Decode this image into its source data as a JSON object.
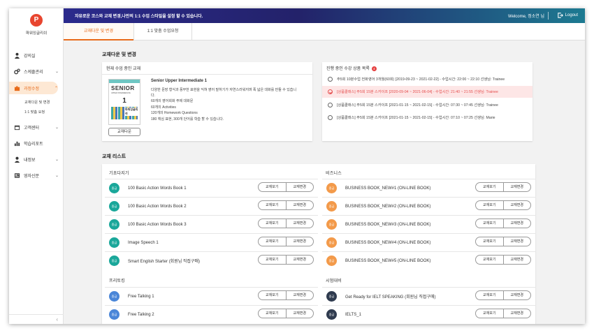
{
  "app": {
    "logo_letter": "P",
    "logo_text": "파워잉글리쉬"
  },
  "sidebar": {
    "items": [
      {
        "label": "강의실",
        "icon": "person-icon"
      },
      {
        "label": "스케줄관리",
        "icon": "gears-icon"
      },
      {
        "label": "과정수정",
        "icon": "puzzle-icon"
      },
      {
        "label": "고객센터",
        "icon": "calendar-icon"
      },
      {
        "label": "학습리포트",
        "icon": "report-icon"
      },
      {
        "label": "내정보",
        "icon": "user-icon"
      },
      {
        "label": "영자신문",
        "icon": "newspaper-icon"
      }
    ],
    "sub_items": [
      "교재다운 및 변경",
      "1:1 맞춤 요청"
    ],
    "collapse": "‹"
  },
  "topbar": {
    "notice": "자유로운 코스와 교재 변경,나만의 1:1 수업 스타일을 설정 할 수 있습니다.",
    "welcome": "Welcome, 정소연 님",
    "logout": "Logout"
  },
  "tabs": [
    {
      "label": "교재다운 및 변경"
    },
    {
      "label": "1:1 맞춤 수업요청"
    }
  ],
  "section1_title": "교재다운 및 변경",
  "current": {
    "header": "현재 수업 중인 교재",
    "book_title": "Senior Upper Intermediate 1",
    "cover": {
      "title": "SENIOR",
      "sub": "UPPER INTERMEDIATE",
      "num": "1",
      "brand": "파워잉글리쉬"
    },
    "desc": [
      "다양한 문장 형식과 풍부한 표현을 익혀 영어 말하기가 자연스러워지며 폭 넓은 대화를 만들 수 있습니",
      "다.",
      "60개의 영어회화 주제 대화문",
      "60개의 Activities",
      "120개의 Homework Questions",
      "180 핵심 표현, 300개 단어를 학습 할 수 있습니다."
    ],
    "download_label": "교재다운"
  },
  "progress": {
    "header": "진행 중인 수강 상품 목록",
    "badge": "4",
    "rows": [
      {
        "text": "주5회 10분수업 전화영어 3개월(60회) [2019-09-23 ~ 2021-02-22] - 수업시간: 22:00 ~ 22:10 선생님: Trainee",
        "selected": false
      },
      {
        "text": "[상품클래스] 주5회 15분 스카이프 [2020-09-04 ~ 2021-06-04] - 수업시간: 21:40 ~ 21:55 선생님: Trainee",
        "selected": true
      },
      {
        "text": "[상품클래스] 주5회 15분 스카이프 [2021-01-15 ~ 2021-02-15] - 수업시간: 07:30 ~ 07:45 선생님: Trainee",
        "selected": false
      },
      {
        "text": "[상품클래스] 주5회 15분 스카이프 [2021-01-15 ~ 2021-02-15] - 수업시간: 07:10 ~ 07:25 선생님: Marie",
        "selected": false
      }
    ]
  },
  "section2_title": "교재 리스트",
  "book_buttons": {
    "view": "교재보기",
    "change": "교재변경"
  },
  "colors": {
    "teal": "#1aa79a",
    "orange": "#f39a4a",
    "blue": "#4a86d8",
    "navy": "#2f3b4f",
    "accent": "#e86b1a"
  },
  "lists": {
    "left_top": {
      "category": "기초다지기",
      "books": [
        {
          "level": "중급",
          "name": "100 Basic Action Words Book 1",
          "color": "#1aa79a"
        },
        {
          "level": "중급",
          "name": "100 Basic Action Words Book 2",
          "color": "#1aa79a"
        },
        {
          "level": "중급",
          "name": "100 Basic Action Words Book 3",
          "color": "#1aa79a"
        },
        {
          "level": "중급",
          "name": "Image Speech 1",
          "color": "#1aa79a"
        },
        {
          "level": "중급",
          "name": "Smart English Starter (회원님 직접구매)",
          "color": "#1aa79a"
        }
      ]
    },
    "right_top": {
      "category": "비즈니스",
      "books": [
        {
          "level": "중급",
          "name": "BUSINESS BOOK_NEW#1 (ON-LINE BOOK)",
          "color": "#f39a4a"
        },
        {
          "level": "중급",
          "name": "BUSINESS BOOK_NEW#2 (ON-LINE BOOK)",
          "color": "#f39a4a"
        },
        {
          "level": "중급",
          "name": "BUSINESS BOOK_NEW#3 (ON-LINE BOOK)",
          "color": "#f39a4a"
        },
        {
          "level": "중급",
          "name": "BUSINESS BOOK_NEW#4 (ON-LINE BOOK)",
          "color": "#f39a4a"
        },
        {
          "level": "중급",
          "name": "BUSINESS BOOK_NEW#5 (ON-LINE BOOK)",
          "color": "#f39a4a"
        }
      ]
    },
    "left_bottom": {
      "category": "프리토킹",
      "books": [
        {
          "level": "중급",
          "name": "Free Talking 1",
          "color": "#4a86d8"
        },
        {
          "level": "중급",
          "name": "Free Talking 2",
          "color": "#4a86d8"
        }
      ]
    },
    "right_bottom": {
      "category": "시험대비",
      "books": [
        {
          "level": "중급",
          "name": "Get Ready for IELT SPEAKING (회원님 직접구매)",
          "color": "#2f3b4f"
        },
        {
          "level": "중급",
          "name": "IELTS_1",
          "color": "#2f3b4f"
        }
      ]
    }
  }
}
